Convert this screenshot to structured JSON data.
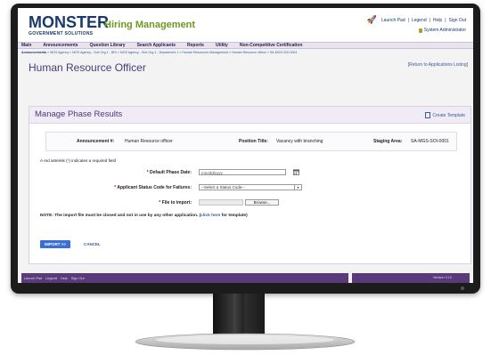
{
  "header": {
    "logo_main": "MONSTER",
    "logo_sub": "GOVERNMENT SOLUTIONS",
    "app_title": "Hiring Management",
    "top_links": [
      "Launch Pad",
      "Legend",
      "Help",
      "Sign Out"
    ],
    "user_role": "System Administrator"
  },
  "nav": {
    "items": [
      "Main",
      "Announcements",
      "Question Library",
      "Search Applicants",
      "Reports",
      "Utility",
      "Non-Competitive Certification"
    ]
  },
  "breadcrumb": {
    "first": "Announcements",
    "rest": "» MGS Agency » MGS Agency - Sub Org 1 - BRI » MGS Agency - Sub Org 1 - Department 1 » Human Resources Management » Human Resource officer » SA-MGS-SOI-0001"
  },
  "page": {
    "title": "Human Resource Officer",
    "return_link": "[Return to Applications Listing]"
  },
  "panel": {
    "title": "Manage Phase Results",
    "create_template": "Create Template",
    "announcement_label": "Announcement #:",
    "announcement_value": "Human Resource officer",
    "position_label": "Position Title:",
    "position_value": "Vacancy with branching",
    "staging_label": "Staging Area:",
    "staging_value": "SA-MGS-SOI-0001",
    "required_note_prefix": "A red asterisk (",
    "required_note_star": "*",
    "required_note_suffix": ") indicates a required field",
    "default_phase_label": "Default Phase Date:",
    "default_phase_placeholder": "mm/dd/yyyy",
    "status_code_label": "Applicant Status Code for Failures:",
    "status_code_value": "--Select a Status Code--",
    "file_label": "File to import:",
    "browse_label": "Browse...",
    "note_prefix": "NOTE: The import file must be closed and not in use by any other application. (",
    "note_link": "click here",
    "note_suffix": " for template)",
    "import_label": "IMPORT >>",
    "cancel_label": "CANCEL"
  },
  "footer": {
    "links": [
      "Launch Pad",
      "Legend",
      "Help",
      "Sign Out"
    ],
    "version": "Version 3.12"
  },
  "colors": {
    "brand_navy": "#1a3a6b",
    "brand_green": "#6b9a1f",
    "accent_purple": "#5a3a7a",
    "button_blue": "#3a6fd8"
  }
}
